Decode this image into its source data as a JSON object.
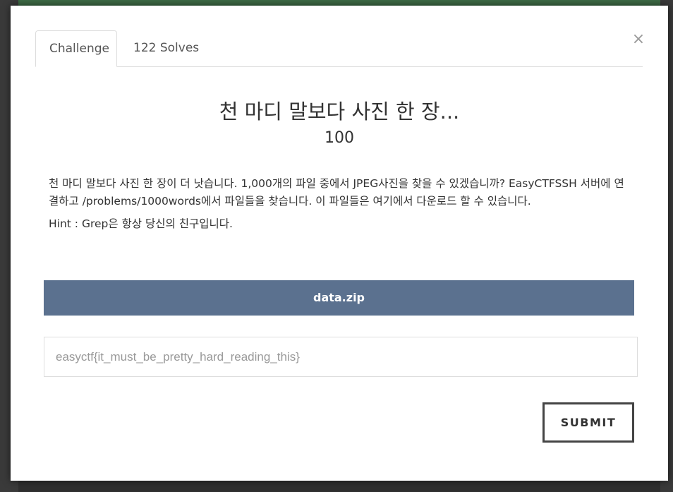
{
  "modal": {
    "close_symbol": "×",
    "tabs": [
      {
        "label": "Challenge",
        "active": true
      },
      {
        "label": "122 Solves",
        "active": false
      }
    ],
    "challenge": {
      "title": "천 마디 말보다 사진 한 장...",
      "points": "100",
      "description": [
        "천 마디 말보다 사진 한 장이 더 낫습니다. 1,000개의 파일 중에서 JPEG사진을 찾을 수 있겠습니까? EasyCTFSSH 서버에 연결하고 /problems/1000words에서 파일들을 찾습니다. 이 파일들은 여기에서 다운로드 할 수 있습니다.",
        "Hint : Grep은 항상 당신의 친구입니다."
      ],
      "file_label": "data.zip"
    },
    "flag_input": {
      "value": "",
      "placeholder": "easyctf{it_must_be_pretty_hard_reading_this}"
    },
    "submit_label": "SUBMIT"
  },
  "colors": {
    "file_button": "#5b718f",
    "backdrop_header": "#3d6b45",
    "submit_border": "#444444"
  }
}
